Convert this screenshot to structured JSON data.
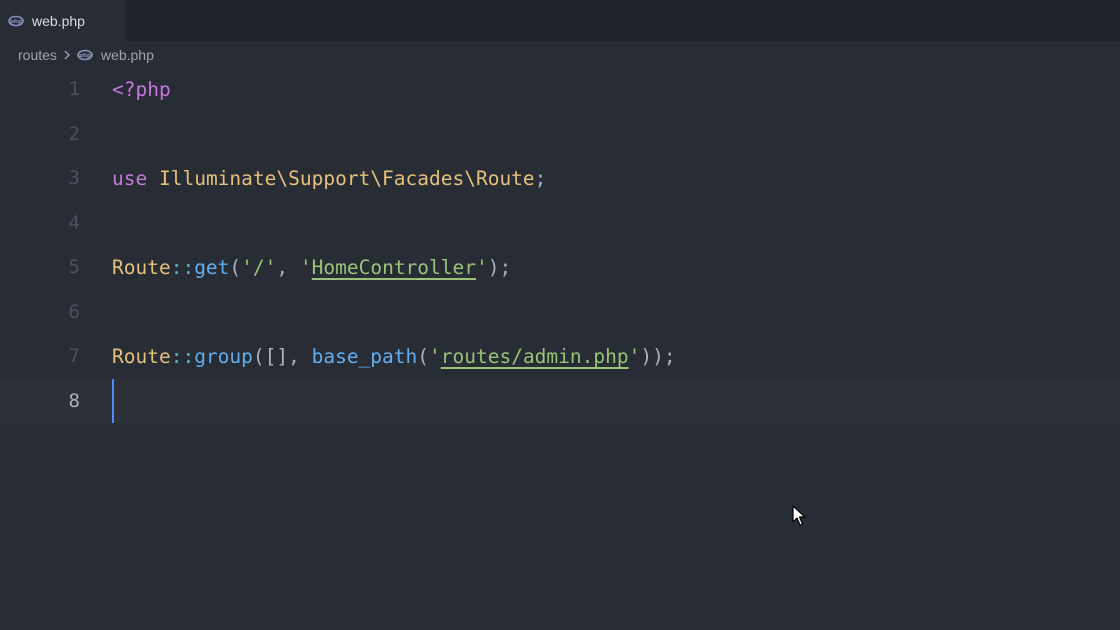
{
  "tabs": [
    {
      "label": "web.php",
      "icon": "php-elephant-icon",
      "active": true
    }
  ],
  "breadcrumb": {
    "folder": "routes",
    "file": "web.php"
  },
  "editor": {
    "lines": [
      {
        "number": "1"
      },
      {
        "number": "2"
      },
      {
        "number": "3"
      },
      {
        "number": "4"
      },
      {
        "number": "5"
      },
      {
        "number": "6"
      },
      {
        "number": "7"
      },
      {
        "number": "8"
      }
    ],
    "code": {
      "l1_open": "<?php",
      "l3_use": "use",
      "l3_ns": "Illuminate\\Support\\Facades\\Route",
      "l3_semi": ";",
      "l5_cls": "Route",
      "l5_op": "::",
      "l5_fn": "get",
      "l5_p1": "(",
      "l5_s1": "'/'",
      "l5_c": ", ",
      "l5_q1": "'",
      "l5_s2": "HomeController",
      "l5_q2": "'",
      "l5_end": ");",
      "l7_cls": "Route",
      "l7_op": "::",
      "l7_fn": "group",
      "l7_args": "([], ",
      "l7_fn2": "base_path",
      "l7_p1": "(",
      "l7_q1": "'",
      "l7_s": "routes/admin.php",
      "l7_q2": "'",
      "l7_end": "));"
    },
    "current_line": "8"
  },
  "colors": {
    "background": "#282c34",
    "keyword": "#c678dd",
    "class": "#e5c07b",
    "function": "#61afef",
    "string": "#98c379",
    "cursor": "#528bff"
  }
}
